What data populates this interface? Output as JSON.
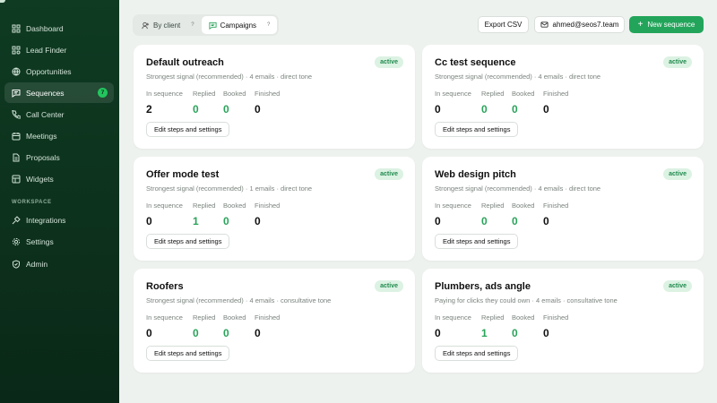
{
  "sidebar": {
    "items": [
      {
        "label": "Dashboard",
        "icon": "grid-icon"
      },
      {
        "label": "Lead Finder",
        "icon": "lead-finder-icon"
      },
      {
        "label": "Opportunities",
        "icon": "globe-icon"
      },
      {
        "label": "Sequences",
        "icon": "message-icon",
        "badge": "7",
        "active": true
      },
      {
        "label": "Call Center",
        "icon": "phone-icon"
      },
      {
        "label": "Meetings",
        "icon": "calendar-icon"
      },
      {
        "label": "Proposals",
        "icon": "document-icon"
      },
      {
        "label": "Widgets",
        "icon": "widgets-icon"
      }
    ],
    "section_label": "WORKSPACE",
    "workspace_items": [
      {
        "label": "Integrations",
        "icon": "plug-icon"
      },
      {
        "label": "Settings",
        "icon": "gear-icon"
      },
      {
        "label": "Admin",
        "icon": "shield-icon"
      }
    ]
  },
  "toolbar": {
    "tab_by_client": "By client",
    "tab_campaigns": "Campaigns",
    "help_mark": "?",
    "export_label": "Export CSV",
    "email_label": "ahmed@seos7.team",
    "new_label": "New sequence"
  },
  "stat_labels": {
    "in_sequence": "In sequence",
    "replied": "Replied",
    "booked": "Booked",
    "finished": "Finished"
  },
  "edit_label": "Edit steps and settings",
  "cards": [
    {
      "title": "Default outreach",
      "status": "active",
      "desc": "Strongest signal (recommended) · 4 emails · direct tone",
      "in_sequence": "2",
      "replied": "0",
      "booked": "0",
      "finished": "0"
    },
    {
      "title": "Cc test sequence",
      "status": "active",
      "desc": "Strongest signal (recommended) · 4 emails · direct tone",
      "in_sequence": "0",
      "replied": "0",
      "booked": "0",
      "finished": "0"
    },
    {
      "title": "Offer mode test",
      "status": "active",
      "desc": "Strongest signal (recommended) · 1 emails · direct tone",
      "in_sequence": "0",
      "replied": "1",
      "booked": "0",
      "finished": "0"
    },
    {
      "title": "Web design pitch",
      "status": "active",
      "desc": "Strongest signal (recommended) · 4 emails · direct tone",
      "in_sequence": "0",
      "replied": "0",
      "booked": "0",
      "finished": "0"
    },
    {
      "title": "Roofers",
      "status": "active",
      "desc": "Strongest signal (recommended) · 4 emails · consultative tone",
      "in_sequence": "0",
      "replied": "0",
      "booked": "0",
      "finished": "0"
    },
    {
      "title": "Plumbers, ads angle",
      "status": "active",
      "desc": "Paying for clicks they could own · 4 emails · consultative tone",
      "in_sequence": "0",
      "replied": "1",
      "booked": "0",
      "finished": "0"
    }
  ],
  "colors": {
    "sidebar_bg": "#0f3b22",
    "accent": "#22a55a",
    "page_bg": "#eef2ef",
    "active_badge_bg": "#dcf2e3"
  }
}
